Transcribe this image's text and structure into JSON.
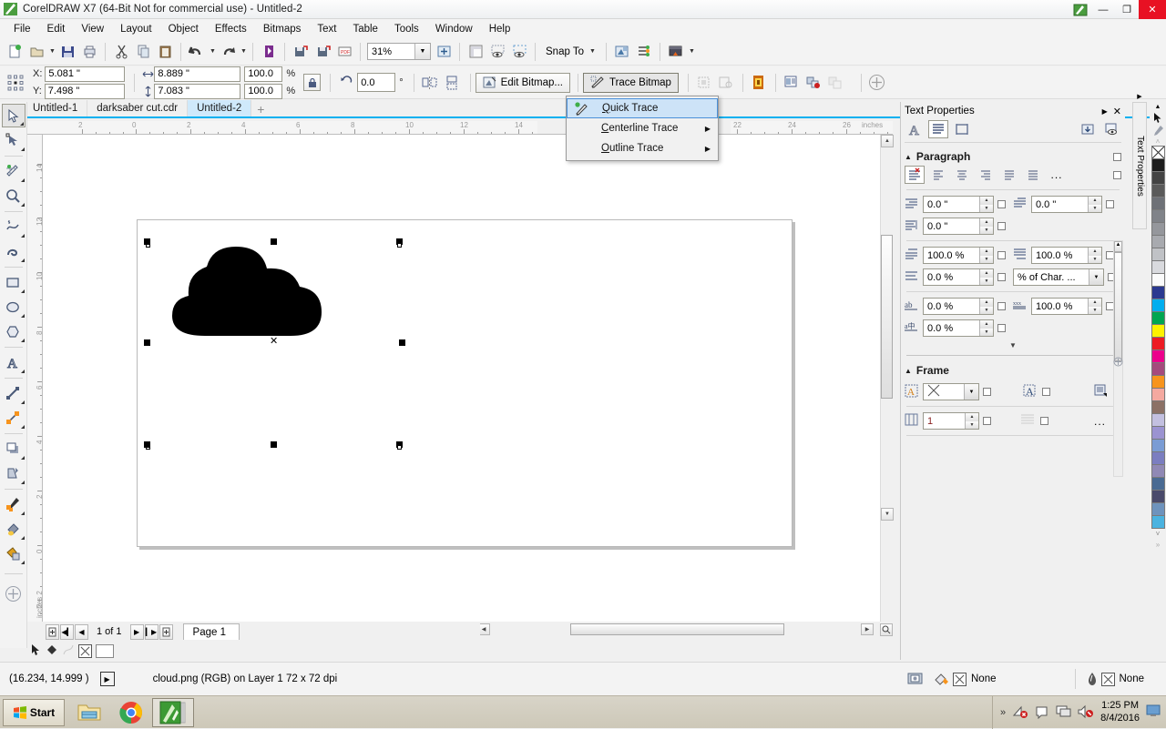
{
  "window": {
    "title": "CorelDRAW X7 (64-Bit Not for commercial use) - Untitled-2",
    "minimize": "—",
    "maximize": "❐",
    "close": "✕"
  },
  "menubar": {
    "items": [
      "File",
      "Edit",
      "View",
      "Layout",
      "Object",
      "Effects",
      "Bitmaps",
      "Text",
      "Table",
      "Tools",
      "Window",
      "Help"
    ]
  },
  "toolbar": {
    "zoom_level": "31%",
    "snap_to": "Snap To",
    "icons": [
      "new-document-icon",
      "open-icon",
      "save-icon",
      "print-icon",
      "cut-icon",
      "copy-icon",
      "paste-icon",
      "undo-icon",
      "redo-icon",
      "import-icon",
      "export-icon",
      "publish-pdf-icon",
      "zoom-levels-combo",
      "full-screen-preview-icon",
      "show-rulers-icon",
      "show-grid-icon",
      "show-guides-icon",
      "snap-to-button",
      "options-icon",
      "object-manager-icon",
      "application-launcher-icon"
    ]
  },
  "propertybar": {
    "x_label": "X:",
    "y_label": "Y:",
    "x_value": "5.081 \"",
    "y_value": "7.498 \"",
    "width_value": "8.889 \"",
    "height_value": "7.083 \"",
    "scale_w": "100.0",
    "scale_h": "100.0",
    "percent": "%",
    "rotation_value": "0.0",
    "degree": "°",
    "edit_bitmap": "Edit Bitmap...",
    "trace_bitmap": "Trace Bitmap"
  },
  "trace_menu": {
    "items": [
      {
        "label": "Quick Trace",
        "accel": "Q",
        "submenu": false,
        "highlighted": true,
        "icon": "quick-trace-icon"
      },
      {
        "label": "Centerline Trace",
        "accel": "C",
        "submenu": true,
        "highlighted": false,
        "icon": ""
      },
      {
        "label": "Outline Trace",
        "accel": "O",
        "submenu": true,
        "highlighted": false,
        "icon": ""
      }
    ],
    "arrow": "▶"
  },
  "tabs": {
    "items": [
      {
        "label": "Untitled-1",
        "active": false
      },
      {
        "label": "darksaber cut.cdr",
        "active": false
      },
      {
        "label": "Untitled-2",
        "active": true
      }
    ],
    "add_label": "+"
  },
  "toolbox": {
    "tools": [
      {
        "name": "pick-tool",
        "selected": true
      },
      {
        "name": "shape-tool",
        "selected": false
      },
      {
        "name": "crop-tool",
        "selected": false
      },
      {
        "name": "zoom-tool",
        "selected": false
      },
      {
        "name": "freehand-tool",
        "selected": false
      },
      {
        "name": "artistic-media-tool",
        "selected": false
      },
      {
        "name": "rectangle-tool",
        "selected": false
      },
      {
        "name": "ellipse-tool",
        "selected": false
      },
      {
        "name": "polygon-tool",
        "selected": false
      },
      {
        "name": "text-tool",
        "selected": false
      },
      {
        "name": "parallel-dimension-tool",
        "selected": false
      },
      {
        "name": "straight-line-connector-tool",
        "selected": false
      },
      {
        "name": "drop-shadow-tool",
        "selected": false
      },
      {
        "name": "transparency-tool",
        "selected": false
      },
      {
        "name": "color-eyedropper-tool",
        "selected": false
      },
      {
        "name": "interactive-fill-tool",
        "selected": false
      },
      {
        "name": "smart-fill-tool",
        "selected": false
      },
      {
        "name": "quick-customize-tool",
        "selected": false
      }
    ]
  },
  "rulers": {
    "unit": "inches",
    "h_labels": [
      "2",
      "0",
      "2",
      "4",
      "6",
      "8",
      "10",
      "12",
      "14",
      "22",
      "24",
      "26"
    ],
    "v_labels": [
      "14",
      "12",
      "10",
      "8",
      "6",
      "4",
      "2",
      "0",
      "2"
    ],
    "v_unit": "inches 2"
  },
  "canvas": {
    "object_name": "cloud-bitmap",
    "center_marker": "✕"
  },
  "pagenav": {
    "counter": "1 of 1",
    "page_tab": "Page 1",
    "first": "◀▎",
    "prev": "◀",
    "next": "▶",
    "last": "▎▶",
    "add": "+"
  },
  "docker": {
    "title": "Text Properties",
    "collapse_arrow": "▶",
    "tab_label": "Text Properties",
    "tabs": [
      "character-tab",
      "paragraph-tab",
      "frame-tab"
    ],
    "paragraph": {
      "heading": "Paragraph",
      "expand": "▲",
      "align_options": [
        "no-alignment",
        "left-align",
        "center-align",
        "right-align",
        "full-justify",
        "force-justify"
      ],
      "more": "...",
      "first_line_indent": "0.0 \"",
      "left_indent": "0.0 \"",
      "right_indent": "0.0 \"",
      "before_paragraph": "100.0 %",
      "after_paragraph": "100.0 %",
      "line_spacing": "0.0 %",
      "spacing_units": "% of Char. ...",
      "character_spacing": "0.0 %",
      "word_spacing": "100.0 %",
      "language_spacing": "0.0 %",
      "more_arrow": "▼"
    },
    "frame": {
      "heading": "Frame",
      "expand": "▲",
      "vertical_alignment": "none-select",
      "columns": "1",
      "more": "..."
    }
  },
  "palette": {
    "up_arrow": "▲",
    "down_arrow": "▼",
    "expand": "»",
    "colors": [
      "none",
      "#1c1c1c",
      "#434343",
      "#5a5a5a",
      "#6e7177",
      "#808389",
      "#95979c",
      "#a8aaaf",
      "#c0c2c6",
      "#d9dade",
      "#fbfbfb",
      "#2b3990",
      "#00aeef",
      "#00a651",
      "#fff200",
      "#ed1c24",
      "#ec008c",
      "#a54a7d",
      "#f7941d",
      "#f4a9a0",
      "#8c7166",
      "#c3c0e0",
      "#9b93d1",
      "#7a9cd4",
      "#7b7ec0",
      "#9089b5",
      "#4a6b93",
      "#4a4a6b",
      "#6e93bd",
      "#4bb3e0"
    ]
  },
  "statusbar": {
    "coordinates": "(16.234, 14.999 )",
    "expand_arrow": "▶",
    "object_info": "cloud.png (RGB) on Layer 1 72 x 72 dpi",
    "fill_label": "None",
    "outline_label": "None"
  },
  "taskbar": {
    "start_label": "Start",
    "apps": [
      "windows-explorer-icon",
      "google-chrome-icon",
      "coreldraw-icon"
    ],
    "tray_icons": [
      "show-hidden-icons",
      "network-icon",
      "action-center-icon",
      "remote-desktop-icon",
      "volume-muted-icon",
      "show-desktop-icon"
    ],
    "tray_expand": "»",
    "time": "1:25 PM",
    "date": "8/4/2016"
  }
}
